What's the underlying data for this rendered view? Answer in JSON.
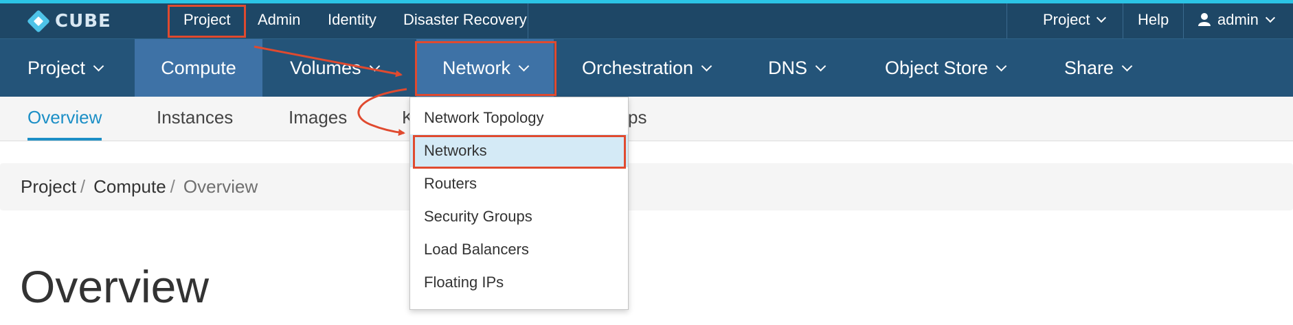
{
  "brand": {
    "logo_text": "CUBE"
  },
  "topbar": {
    "links": [
      "Project",
      "Admin",
      "Identity",
      "Disaster Recovery"
    ],
    "project_menu": "Project",
    "help": "Help",
    "user": "admin"
  },
  "main_nav": {
    "items": [
      "Project",
      "Compute",
      "Volumes",
      "Network",
      "Orchestration",
      "DNS",
      "Object Store",
      "Share"
    ],
    "active": "Compute",
    "open": "Network"
  },
  "sub_nav": {
    "items": [
      "Overview",
      "Instances",
      "Images",
      "K",
      "ps"
    ],
    "active": "Overview"
  },
  "breadcrumb": [
    "Project",
    "Compute",
    "Overview"
  ],
  "page": {
    "title": "Overview"
  },
  "network_menu": {
    "items": [
      "Network Topology",
      "Networks",
      "Routers",
      "Security Groups",
      "Load Balancers",
      "Floating IPs"
    ],
    "highlighted": "Networks"
  },
  "colors": {
    "topbar": "#1e4766",
    "main_nav": "#245479",
    "active_nav": "#3e72a6",
    "accent": "#2bc4e6",
    "link_active": "#1c8fc6",
    "annotation": "#e04a2f",
    "menu_highlight": "#d4eaf6"
  }
}
